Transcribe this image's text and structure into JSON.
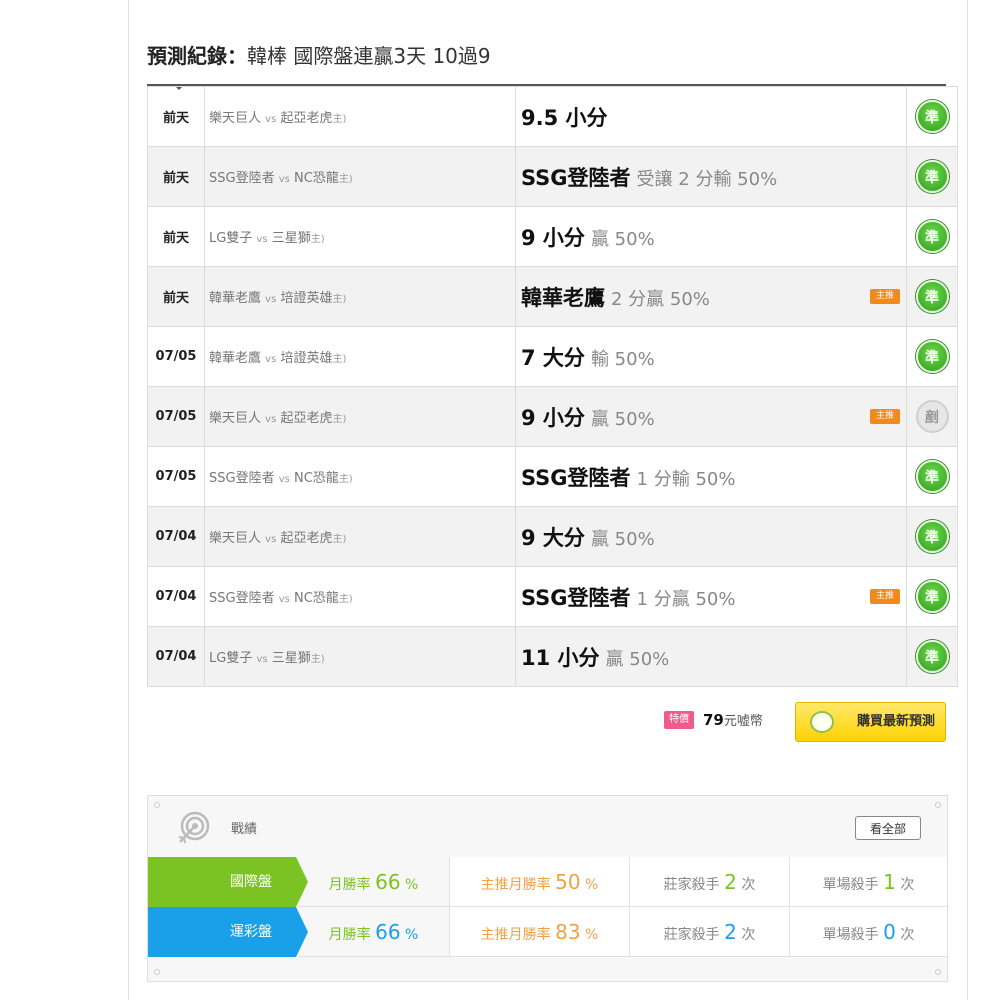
{
  "title": {
    "prefix": "預測紀錄：",
    "main": "韓棒 國際盤連贏3天 10過9"
  },
  "records": [
    {
      "date": "前天",
      "away": "樂天巨人",
      "vs": "vs",
      "home": "起亞老虎",
      "host": "主)",
      "pick": "9.5 小分",
      "detail": "",
      "featured": false,
      "result": "準",
      "result_type": "win"
    },
    {
      "date": "前天",
      "away": "SSG登陸者",
      "vs": "vs",
      "home": "NC恐龍",
      "host": "主)",
      "pick": "SSG登陸者",
      "detail": "受讓 2 分輸 50%",
      "featured": false,
      "result": "準",
      "result_type": "win"
    },
    {
      "date": "前天",
      "away": "LG雙子",
      "vs": "vs",
      "home": "三星獅",
      "host": "主)",
      "pick": "9 小分",
      "detail": "贏 50%",
      "featured": false,
      "result": "準",
      "result_type": "win"
    },
    {
      "date": "前天",
      "away": "韓華老鷹",
      "vs": "vs",
      "home": "培證英雄",
      "host": "主)",
      "pick": "韓華老鷹",
      "detail": "2 分贏 50%",
      "featured": true,
      "result": "準",
      "result_type": "win"
    },
    {
      "date": "07/05",
      "away": "韓華老鷹",
      "vs": "vs",
      "home": "培證英雄",
      "host": "主)",
      "pick": "7 大分",
      "detail": "輸 50%",
      "featured": false,
      "result": "準",
      "result_type": "win"
    },
    {
      "date": "07/05",
      "away": "樂天巨人",
      "vs": "vs",
      "home": "起亞老虎",
      "host": "主)",
      "pick": "9 小分",
      "detail": "贏 50%",
      "featured": true,
      "result": "剷",
      "result_type": "draw"
    },
    {
      "date": "07/05",
      "away": "SSG登陸者",
      "vs": "vs",
      "home": "NC恐龍",
      "host": "主)",
      "pick": "SSG登陸者",
      "detail": "1 分輸 50%",
      "featured": false,
      "result": "準",
      "result_type": "win"
    },
    {
      "date": "07/04",
      "away": "樂天巨人",
      "vs": "vs",
      "home": "起亞老虎",
      "host": "主)",
      "pick": "9 大分",
      "detail": "贏 50%",
      "featured": false,
      "result": "準",
      "result_type": "win"
    },
    {
      "date": "07/04",
      "away": "SSG登陸者",
      "vs": "vs",
      "home": "NC恐龍",
      "host": "主)",
      "pick": "SSG登陸者",
      "detail": "1 分贏 50%",
      "featured": true,
      "result": "準",
      "result_type": "win"
    },
    {
      "date": "07/04",
      "away": "LG雙子",
      "vs": "vs",
      "home": "三星獅",
      "host": "主)",
      "pick": "11 小分",
      "detail": "贏 50%",
      "featured": false,
      "result": "準",
      "result_type": "win"
    }
  ],
  "featured_badge": "主推",
  "buy": {
    "special_tag": "特價",
    "price": "79",
    "price_unit": "元嘘幣",
    "button_label": "購買最新預測"
  },
  "stats": {
    "label": "戰績",
    "view_all": "看全部",
    "rows": [
      {
        "name": "國際盤",
        "monthly_label": "月勝率",
        "monthly_value": "66",
        "featured_label": "主推月勝率",
        "featured_value": "50",
        "bookie_label": "莊家殺手",
        "bookie_value": "2",
        "single_label": "單場殺手",
        "single_value": "1",
        "unit_pct": "%",
        "unit_times": "次",
        "color": "#7bc322"
      },
      {
        "name": "運彩盤",
        "monthly_label": "月勝率",
        "monthly_value": "66",
        "featured_label": "主推月勝率",
        "featured_value": "83",
        "bookie_label": "莊家殺手",
        "bookie_value": "2",
        "single_label": "單場殺手",
        "single_value": "0",
        "unit_pct": "%",
        "unit_times": "次",
        "color": "#1aa0e8"
      }
    ]
  }
}
